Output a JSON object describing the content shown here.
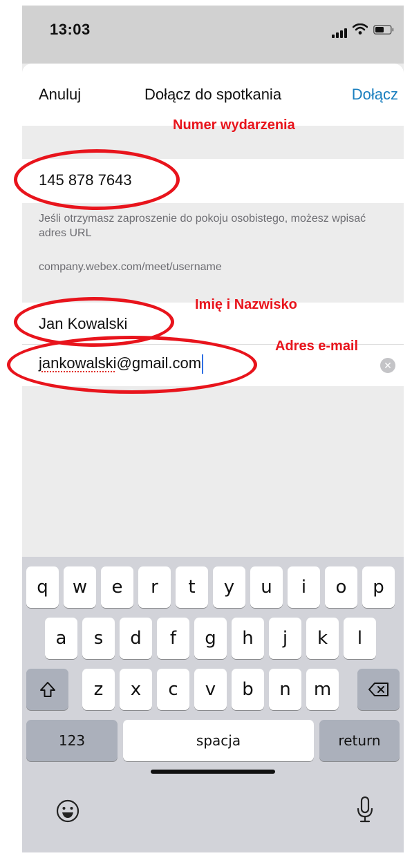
{
  "status_bar": {
    "time": "13:03"
  },
  "nav": {
    "cancel": "Anuluj",
    "title": "Dołącz do spotkania",
    "join": "Dołącz"
  },
  "form": {
    "meeting_number": "145 878 7643",
    "hint_1": "Jeśli otrzymasz zaproszenie do pokoju osobistego, możesz wpisać adres URL",
    "hint_2": "company.webex.com/meet/username",
    "name": "Jan Kowalski",
    "email_misspelled": "jankowalski",
    "email_rest": "@gmail.com"
  },
  "annotations": {
    "meeting_number": "Numer wydarzenia",
    "name": "Imię i Nazwisko",
    "email": "Adres e-mail",
    "color": "#e8141c"
  },
  "keyboard": {
    "row1": [
      "q",
      "w",
      "e",
      "r",
      "t",
      "y",
      "u",
      "i",
      "o",
      "p"
    ],
    "row2": [
      "a",
      "s",
      "d",
      "f",
      "g",
      "h",
      "j",
      "k",
      "l"
    ],
    "row3": [
      "z",
      "x",
      "c",
      "v",
      "b",
      "n",
      "m"
    ],
    "numbers": "123",
    "space": "spacja",
    "return": "return",
    "icons": [
      "shift-icon",
      "backspace-icon",
      "emoji-icon",
      "microphone-icon"
    ]
  },
  "colors": {
    "accent": "#1a7fbf",
    "background": "#ececec",
    "keyboard": "#d2d3d9"
  }
}
